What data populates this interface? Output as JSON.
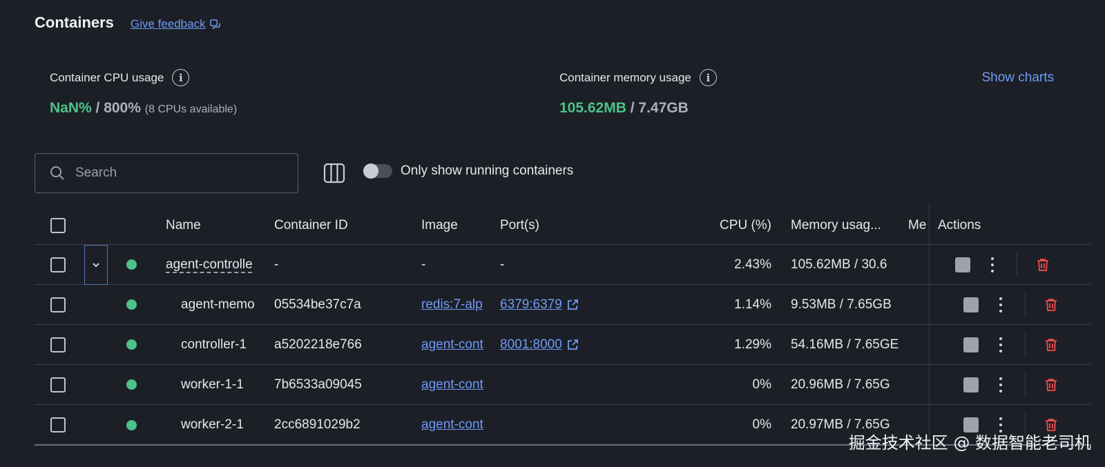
{
  "header": {
    "title": "Containers",
    "feedback_label": "Give feedback"
  },
  "stats": {
    "cpu": {
      "label": "Container CPU usage",
      "value": "NaN%",
      "total": "/ 800%",
      "note": "(8 CPUs available)"
    },
    "memory": {
      "label": "Container memory usage",
      "value": "105.62MB",
      "total": "/ 7.47GB"
    },
    "show_charts_label": "Show charts"
  },
  "toolbar": {
    "search_placeholder": "Search",
    "toggle_label": "Only show running containers"
  },
  "table": {
    "columns": {
      "name": "Name",
      "container_id": "Container ID",
      "image": "Image",
      "ports": "Port(s)",
      "cpu": "CPU (%)",
      "memory": "Memory usag...",
      "me": "Me",
      "actions": "Actions"
    },
    "rows": [
      {
        "name": "agent-controlle",
        "id": "-",
        "image": "-",
        "port": "-",
        "cpu": "2.43%",
        "memory": "105.62MB / 30.6"
      },
      {
        "name": "agent-memo",
        "id": "05534be37c7a",
        "image": "redis:7-alp",
        "port": "6379:6379",
        "cpu": "1.14%",
        "memory": "9.53MB / 7.65GB"
      },
      {
        "name": "controller-1",
        "id": "a5202218e766",
        "image": "agent-cont",
        "port": "8001:8000",
        "cpu": "1.29%",
        "memory": "54.16MB / 7.65GE"
      },
      {
        "name": "worker-1-1",
        "id": "7b6533a09045",
        "image": "agent-cont",
        "port": "",
        "cpu": "0%",
        "memory": "20.96MB / 7.65G"
      },
      {
        "name": "worker-2-1",
        "id": "2cc6891029b2",
        "image": "agent-cont",
        "port": "",
        "cpu": "0%",
        "memory": "20.97MB / 7.65G"
      }
    ]
  },
  "watermark": "掘金技术社区 @ 数据智能老司机",
  "colors": {
    "background": "#1c1f26",
    "accent": "#6f9bf7",
    "running": "#4cc38a",
    "danger": "#e5484d"
  }
}
